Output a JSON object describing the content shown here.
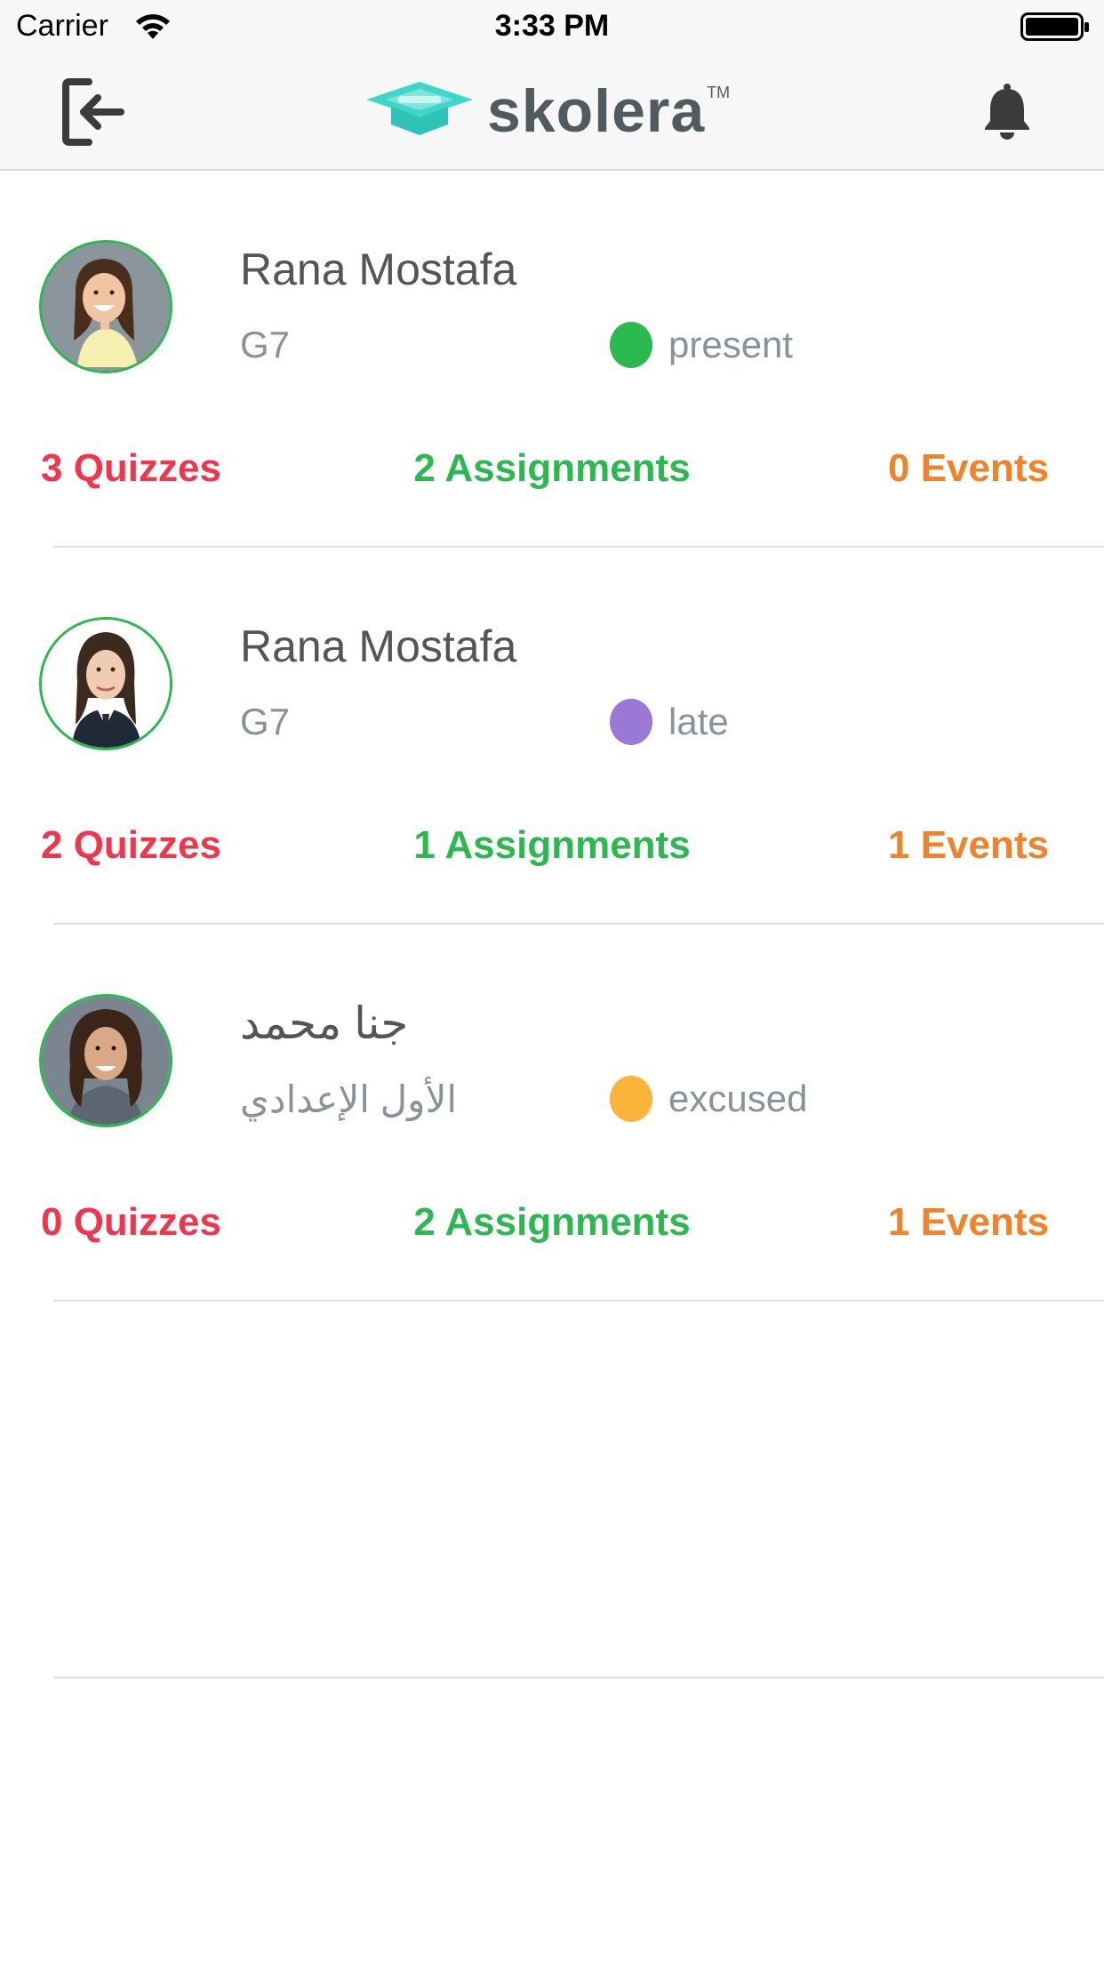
{
  "status_bar": {
    "carrier": "Carrier",
    "time": "3:33 PM"
  },
  "nav_bar": {
    "logo_text": "skolera",
    "logo_tm": "TM",
    "logout_icon": "logout-icon",
    "bell_icon": "bell-icon"
  },
  "colors": {
    "brand": "#3dd6c8",
    "quizzes": "#f2344d",
    "assignments": "#2bb84e",
    "events": "#f0822a",
    "present": "#2bb84e",
    "late": "#9a78d6",
    "excused": "#fbb43a"
  },
  "students": [
    {
      "name": "Rana Mostafa",
      "grade": "G7",
      "status": "present",
      "status_color": "#2bb84e",
      "quizzes": "3 Quizzes",
      "assignments": "2 Assignments",
      "events": "0 Events"
    },
    {
      "name": "Rana Mostafa",
      "grade": "G7",
      "status": "late",
      "status_color": "#9a78d6",
      "quizzes": "2 Quizzes",
      "assignments": "1 Assignments",
      "events": "1 Events"
    },
    {
      "name": "جنا محمد",
      "grade": "الأول الإعدادي",
      "status": "excused",
      "status_color": "#fbb43a",
      "quizzes": "0 Quizzes",
      "assignments": "2 Assignments",
      "events": "1 Events"
    }
  ]
}
